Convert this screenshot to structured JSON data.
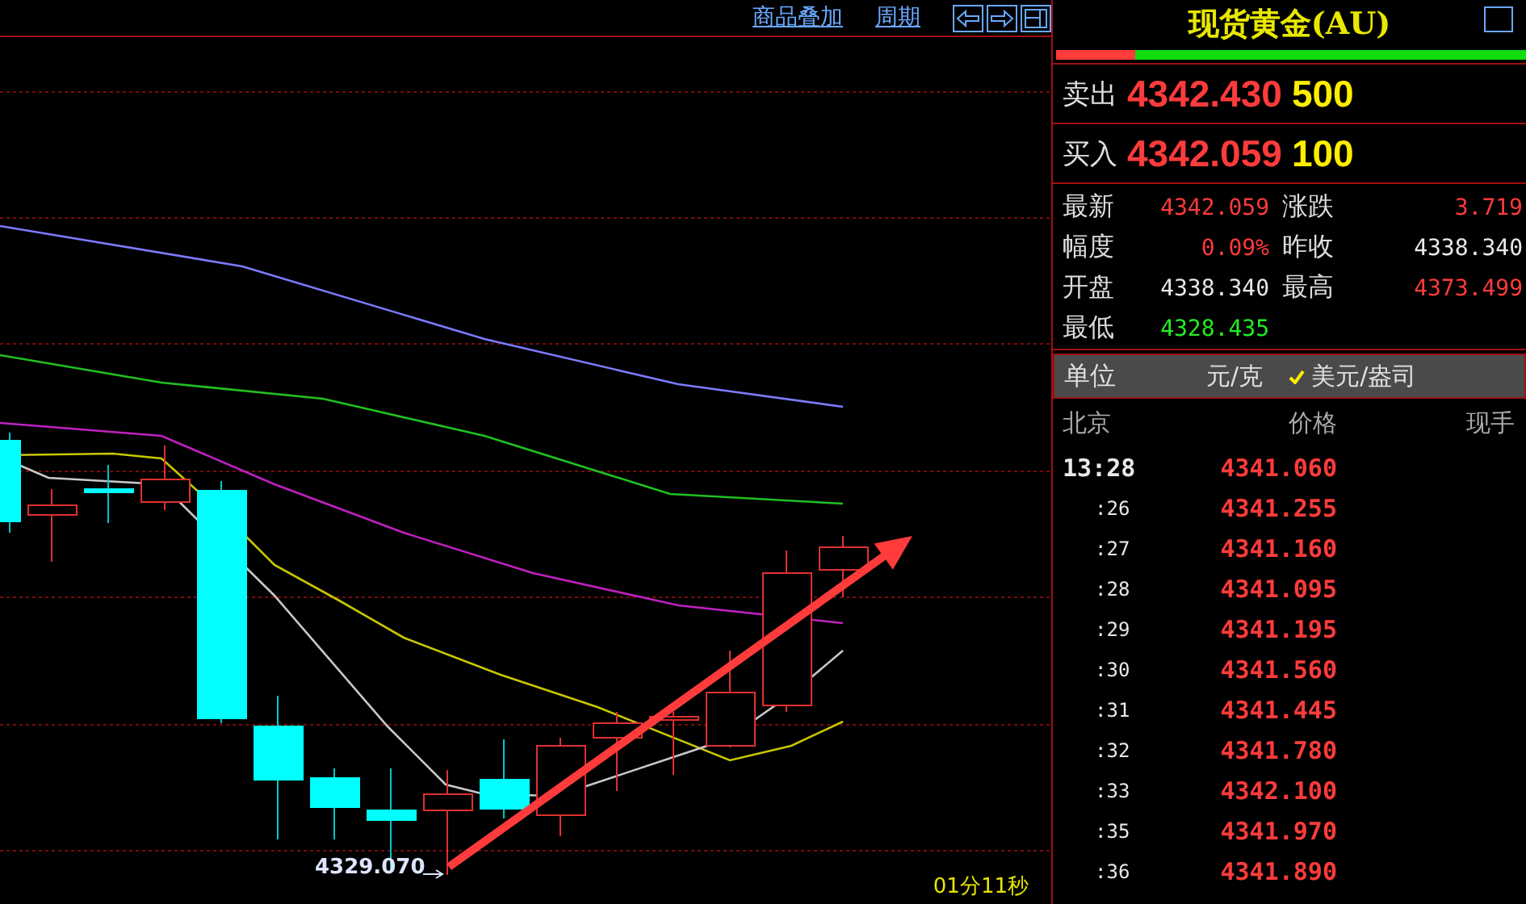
{
  "toolbar": {
    "links": [
      {
        "label": "商品叠加"
      },
      {
        "label": "周期"
      }
    ]
  },
  "chart": {
    "low_label": "4329.070",
    "timer": "01分11秒"
  },
  "quote": {
    "title": "现货黄金(AU)",
    "ratio": {
      "level": 0.17
    },
    "sell": {
      "label": "卖出",
      "price": "4342.430",
      "volume": "500"
    },
    "buy": {
      "label": "买入",
      "price": "4342.059",
      "volume": "100"
    },
    "stats": [
      {
        "label": "最新",
        "value": "4342.059",
        "color": "#ff3b3b"
      },
      {
        "label": "涨跌",
        "value": "3.719",
        "color": "#ff3b3b"
      },
      {
        "label": "幅度",
        "value": "0.09%",
        "color": "#ff3b3b"
      },
      {
        "label": "昨收",
        "value": "4338.340",
        "color": "#e8e8e8"
      },
      {
        "label": "开盘",
        "value": "4338.340",
        "color": "#e8e8e8"
      },
      {
        "label": "最高",
        "value": "4373.499",
        "color": "#ff3b3b"
      },
      {
        "label": "最低",
        "value": "4328.435",
        "color": "#22ee22"
      }
    ],
    "units": {
      "label": "单位",
      "options": [
        {
          "label": "元/克",
          "selected": false
        },
        {
          "label": "美元/盎司",
          "selected": true
        }
      ]
    },
    "ticks": {
      "columns": [
        "北京",
        "价格",
        "现手"
      ],
      "rows": [
        {
          "time": "13:28",
          "price": "4341.060",
          "kind": "minute"
        },
        {
          "time": ":26",
          "price": "4341.255",
          "kind": "second"
        },
        {
          "time": ":27",
          "price": "4341.160",
          "kind": "second"
        },
        {
          "time": ":28",
          "price": "4341.095",
          "kind": "second"
        },
        {
          "time": ":29",
          "price": "4341.195",
          "kind": "second"
        },
        {
          "time": ":30",
          "price": "4341.560",
          "kind": "second"
        },
        {
          "time": ":31",
          "price": "4341.445",
          "kind": "second"
        },
        {
          "time": ":32",
          "price": "4341.780",
          "kind": "second"
        },
        {
          "time": ":33",
          "price": "4342.100",
          "kind": "second"
        },
        {
          "time": ":35",
          "price": "4341.970",
          "kind": "second"
        },
        {
          "time": ":36",
          "price": "4341.890",
          "kind": "second"
        }
      ]
    }
  }
}
